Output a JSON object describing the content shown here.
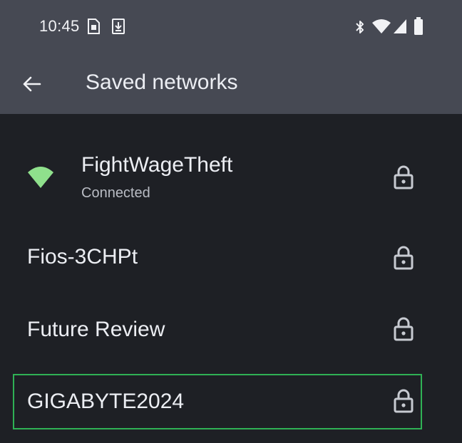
{
  "status_bar": {
    "time": "10:45",
    "notification_icons": [
      "sim-card-icon",
      "download-icon"
    ],
    "system_icons": [
      "bluetooth-icon",
      "wifi-icon",
      "cell-signal-icon",
      "battery-icon"
    ]
  },
  "app_bar": {
    "back_icon": "arrow-back-icon",
    "title": "Saved networks"
  },
  "networks": [
    {
      "name": "FightWageTheft",
      "status": "Connected",
      "icon": "wifi-icon",
      "secured": true,
      "connected": true
    },
    {
      "name": "Fios-3CHPt",
      "secured": true
    },
    {
      "name": "Future Review",
      "secured": true
    },
    {
      "name": "GIGABYTE2024",
      "secured": true,
      "focused": true
    }
  ],
  "colors": {
    "app_bar_bg": "#464953",
    "list_bg": "#1e2025",
    "connected_wifi": "#8fe08c",
    "focus_ring": "#2fb155"
  }
}
